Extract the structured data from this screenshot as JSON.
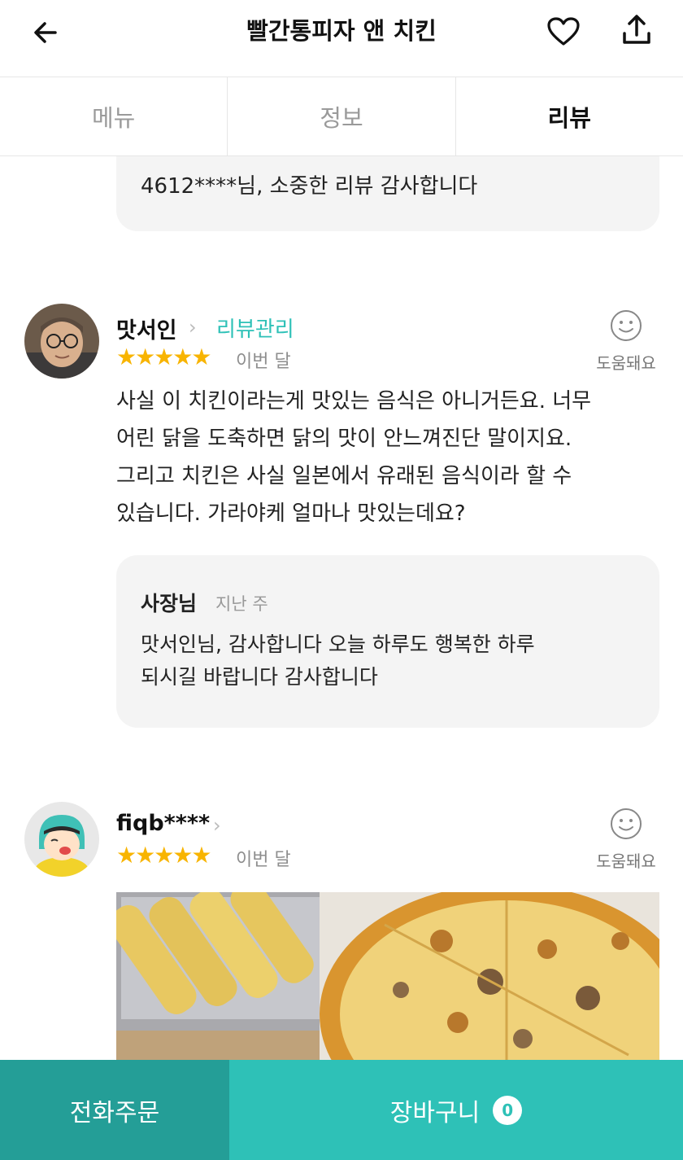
{
  "header": {
    "title": "빨간통피자 앤 치킨",
    "back_icon": "back-arrow-icon",
    "heart_icon": "heart-icon",
    "share_icon": "share-icon"
  },
  "tabs": [
    {
      "label": "메뉴",
      "active": false
    },
    {
      "label": "정보",
      "active": false
    },
    {
      "label": "리뷰",
      "active": true
    }
  ],
  "previous_reply": {
    "text": "4612****님, 소중한 리뷰 감사합니다"
  },
  "reviews": [
    {
      "user": "맛서인",
      "manage_label": "리뷰관리",
      "rating": 5,
      "stars": "★★★★★",
      "date": "이번 달",
      "helpful_label": "도움돼요",
      "body": [
        "사실 이 치킨이라는게 맛있는 음식은 아니거든요. 너무",
        "어린 닭을 도축하면 닭의 맛이 안느껴진단 말이지요.",
        "그리고 치킨은 사실 일본에서 유래된 음식이라 할 수",
        "있습니다. 가라야케 얼마나 맛있는데요?"
      ],
      "reply": {
        "author": "사장님",
        "when": "지난 주",
        "body": [
          "맛서인님, 감사합니다 오늘 하루도 행복한 하루",
          "되시길 바랍니다 감사합니다"
        ]
      }
    },
    {
      "user": "fiqb****",
      "rating": 5,
      "stars": "★★★★★",
      "date": "이번 달",
      "helpful_label": "도움돼요"
    }
  ],
  "bottom_bar": {
    "call_label": "전화주문",
    "cart_label": "장바구니",
    "cart_count": "0"
  },
  "colors": {
    "accent": "#2ec1b7",
    "accent_dark": "#249e97",
    "star": "#f8b400"
  }
}
